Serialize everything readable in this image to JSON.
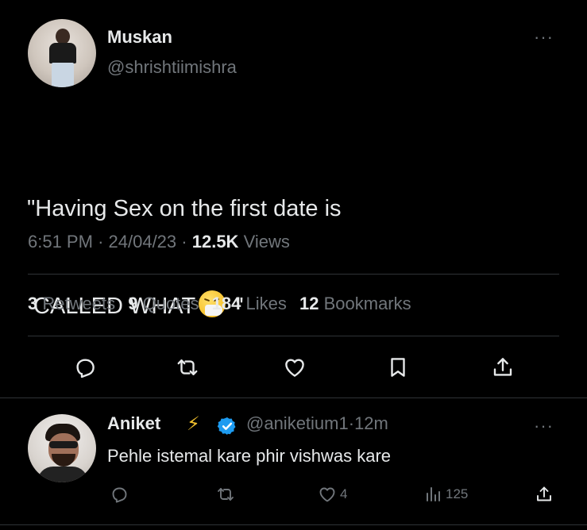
{
  "tweet": {
    "author_name": "Muskan",
    "author_handle": "@shrishtiimishra",
    "more_label": "···",
    "text_line1": "\"Having Sex on the first date is",
    "text_line2_start": " CALLED WHAT",
    "text_line2_end": " \"",
    "emoji": "sneezing-face",
    "time": "6:51 PM",
    "date": "24/04/23",
    "separator": "·",
    "views_count": "12.5K",
    "views_label": "Views",
    "retweets_count": "3",
    "retweets_label": "Retweets",
    "quotes_count": "9",
    "quotes_label": "Quotes",
    "likes_count": "184",
    "likes_label": "Likes",
    "bookmarks_count": "12",
    "bookmarks_label": "Bookmarks",
    "actions": [
      "reply-icon",
      "retweet-icon",
      "like-icon",
      "bookmark-icon",
      "share-icon"
    ]
  },
  "reply": {
    "author_name": "Aniket",
    "bolt": "⚡",
    "verified": true,
    "author_handle": "@aniketium1",
    "separator": "·",
    "age": "12m",
    "more_label": "···",
    "text": "Pehle istemal kare phir vishwas kare",
    "likes_count": "4",
    "views_count": "125",
    "actions": [
      "reply-icon",
      "retweet-icon",
      "like-icon",
      "views-icon",
      "share-icon"
    ]
  },
  "colors": {
    "background": "#000000",
    "text": "#e7e9ea",
    "secondary": "#71767b",
    "divider": "#2f3336",
    "verified": "#1d9bf0",
    "bolt": "#f2c12e"
  }
}
